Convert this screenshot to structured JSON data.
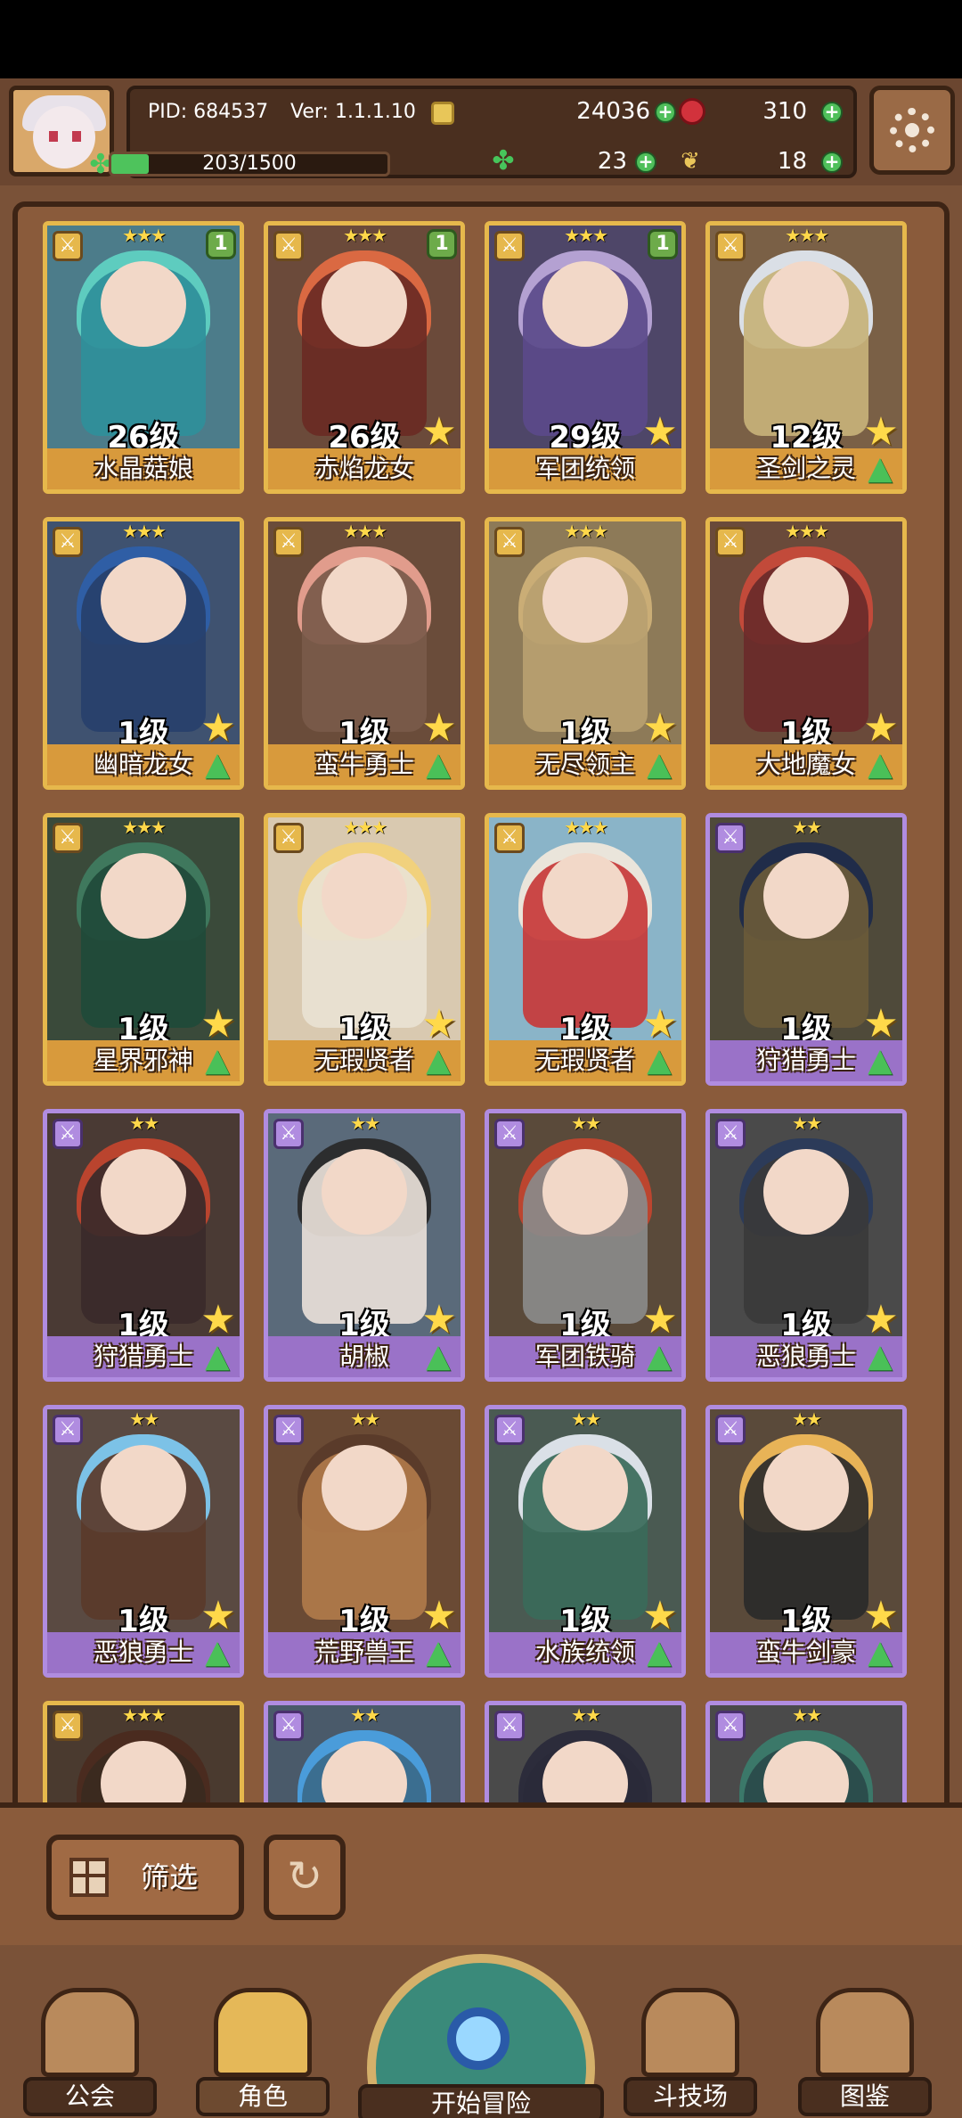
{
  "header": {
    "pid": "PID: 684537",
    "version": "Ver: 1.1.1.10",
    "gold": "24036",
    "ruby": "310",
    "exp_text": "203/1500",
    "exp_progress": 0.135,
    "clover": "23",
    "leaf": "18"
  },
  "cards": [
    {
      "level": "26级",
      "name": "水晶菇娘",
      "badge": "1",
      "type": "golden",
      "hair": "#5fd1c2",
      "body": "#2f8f9a",
      "bg": "#4c7c8a"
    },
    {
      "level": "26级",
      "name": "赤焰龙女",
      "badge": "1",
      "type": "golden",
      "hair": "#e06a42",
      "body": "#6a2a24",
      "bg": "#6b4a3a"
    },
    {
      "level": "29级",
      "name": "军团统领",
      "badge": "1",
      "type": "golden",
      "hair": "#b9a6d8",
      "body": "#5b4a8a",
      "bg": "#4e4668"
    },
    {
      "level": "12级",
      "name": "圣剑之灵",
      "badge": "",
      "type": "golden",
      "hair": "#dfe6ef",
      "body": "#c7b27a",
      "bg": "#7a6046"
    },
    {
      "level": "1级",
      "name": "幽暗龙女",
      "badge": "",
      "type": "golden",
      "hair": "#2e5fa8",
      "body": "#27406b",
      "bg": "#3f5270"
    },
    {
      "level": "1级",
      "name": "蛮牛勇士",
      "badge": "",
      "type": "golden",
      "hair": "#e8a090",
      "body": "#7a5a4a",
      "bg": "#6a4c3a"
    },
    {
      "level": "1级",
      "name": "无尽领主",
      "badge": "",
      "type": "golden",
      "hair": "#cdb078",
      "body": "#b9a070",
      "bg": "#8d7a58"
    },
    {
      "level": "1级",
      "name": "大地魔女",
      "badge": "",
      "type": "golden",
      "hair": "#c74a3a",
      "body": "#6a2a2a",
      "bg": "#6a4a3a"
    },
    {
      "level": "1级",
      "name": "星界邪神",
      "badge": "",
      "type": "golden",
      "hair": "#3f7a5f",
      "body": "#1f4a3a",
      "bg": "#3a4a3a"
    },
    {
      "level": "1级",
      "name": "无瑕贤者",
      "badge": "",
      "type": "golden",
      "hair": "#f2d27a",
      "body": "#e9e2d2",
      "bg": "#d9c9b0"
    },
    {
      "level": "1级",
      "name": "无瑕贤者",
      "badge": "",
      "type": "golden",
      "hair": "#efe8dc",
      "body": "#c73a3a",
      "bg": "#8ab4c8"
    },
    {
      "level": "1级",
      "name": "狩猎勇士",
      "badge": "",
      "type": "purple",
      "hair": "#1d2a4a",
      "body": "#6a5a3a",
      "bg": "#4f4a3a"
    },
    {
      "level": "1级",
      "name": "狩猎勇士",
      "badge": "",
      "type": "purple",
      "hair": "#c0452e",
      "body": "#3a2a2a",
      "bg": "#4a3a34"
    },
    {
      "level": "1级",
      "name": "胡椒",
      "badge": "",
      "type": "purple",
      "hair": "#2a2a2a",
      "body": "#e8e0d8",
      "bg": "#5a6a7a"
    },
    {
      "level": "1级",
      "name": "军团铁骑",
      "badge": "",
      "type": "purple",
      "hair": "#c2452e",
      "body": "#8a8a8a",
      "bg": "#5a4a3a"
    },
    {
      "level": "1级",
      "name": "恶狼勇士",
      "badge": "",
      "type": "purple",
      "hair": "#2a3a5a",
      "body": "#3a3a3a",
      "bg": "#4a4a4a"
    },
    {
      "level": "1级",
      "name": "恶狼勇士",
      "badge": "",
      "type": "purple",
      "hair": "#7ec8f0",
      "body": "#5a3a2a",
      "bg": "#5a4a42"
    },
    {
      "level": "1级",
      "name": "荒野兽王",
      "badge": "",
      "type": "purple",
      "hair": "#5a3a2a",
      "body": "#b07a4a",
      "bg": "#6a4a34"
    },
    {
      "level": "1级",
      "name": "水族统领",
      "badge": "",
      "type": "purple",
      "hair": "#e2e8ef",
      "body": "#3a6a5a",
      "bg": "#4a5a52"
    },
    {
      "level": "1级",
      "name": "蛮牛剑豪",
      "badge": "",
      "type": "purple",
      "hair": "#f0b858",
      "body": "#2a2a2a",
      "bg": "#5a4a3a"
    },
    {
      "level": "",
      "name": "",
      "badge": "",
      "type": "golden",
      "hair": "#4a2a1f",
      "body": "#3a2a1f",
      "bg": "#4a3a2f"
    },
    {
      "level": "",
      "name": "",
      "badge": "",
      "type": "purple",
      "hair": "#4aa0e0",
      "body": "#3a6a8a",
      "bg": "#4a5a6a"
    },
    {
      "level": "",
      "name": "",
      "badge": "",
      "type": "purple",
      "hair": "#2a2a3a",
      "body": "#2a2a3a",
      "bg": "#4a4a4a"
    },
    {
      "level": "",
      "name": "",
      "badge": "",
      "type": "purple",
      "hair": "#3a7a6a",
      "body": "#2a4a4a",
      "bg": "#4a4a4a"
    }
  ],
  "toolbar": {
    "filter_label": "筛选"
  },
  "nav": {
    "guild": "公会",
    "character": "角色",
    "adventure": "开始冒险",
    "arena": "斗技场",
    "codex": "图鉴"
  },
  "colors": {
    "gold_border": "#e6b84c",
    "purple_border": "#b08ce0",
    "bg_brown": "#7a5238"
  }
}
